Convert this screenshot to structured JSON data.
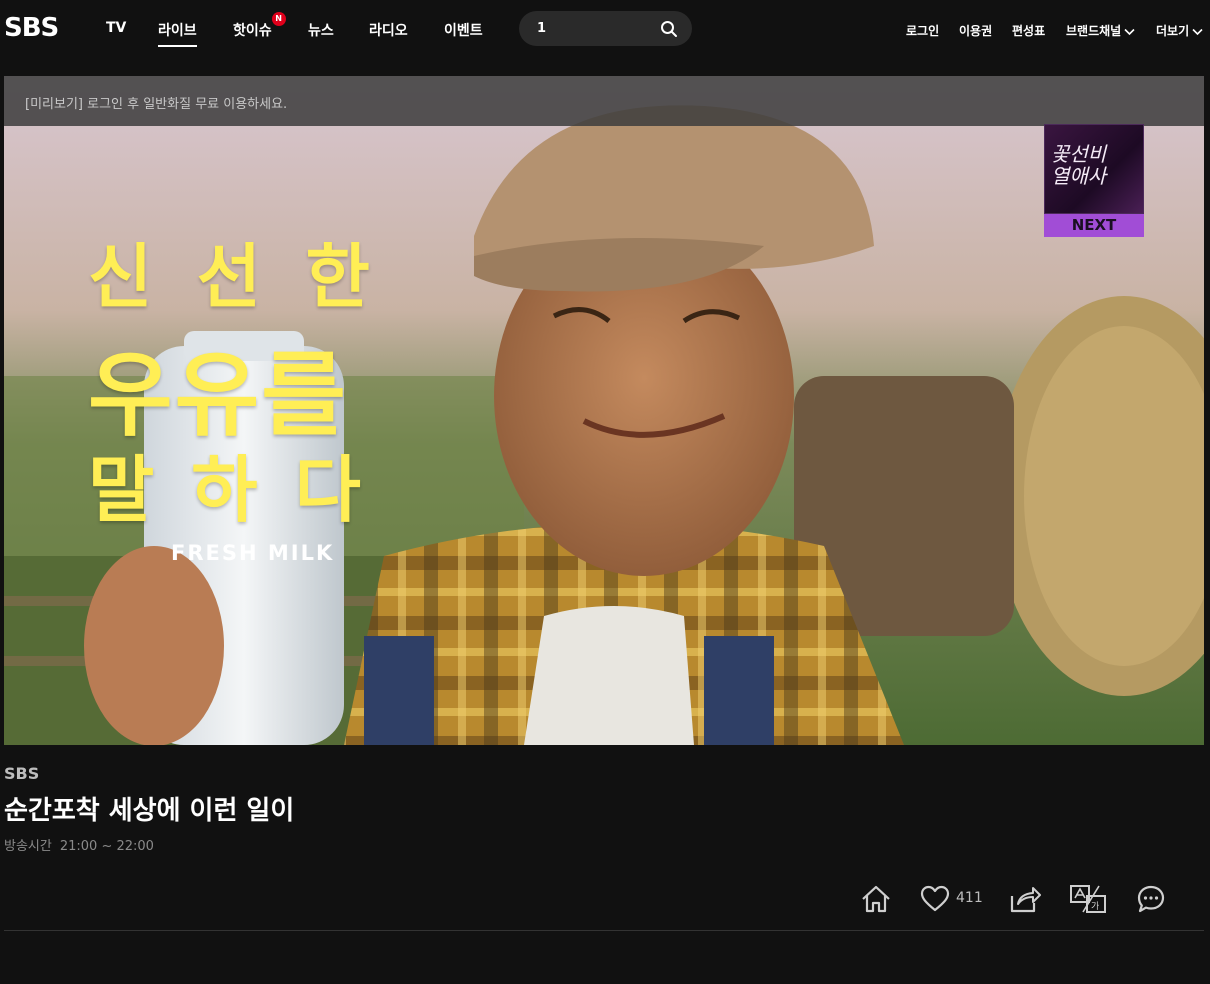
{
  "header": {
    "logo": "SBS",
    "nav": [
      {
        "label": "TV"
      },
      {
        "label": "라이브"
      },
      {
        "label": "핫이슈",
        "badge": "N"
      },
      {
        "label": "뉴스"
      },
      {
        "label": "라디오"
      },
      {
        "label": "이벤트"
      }
    ],
    "search": {
      "value": "1"
    },
    "utility": [
      {
        "label": "로그인"
      },
      {
        "label": "이용권"
      },
      {
        "label": "편성표"
      },
      {
        "label": "브랜드채널"
      },
      {
        "label": "더보기"
      }
    ]
  },
  "player": {
    "preview_notice": "[미리보기] 로그인 후 일반화질 무료 이용하세요.",
    "next": {
      "label": "NEXT",
      "thumb_text": "꽃선비\n열애사"
    },
    "ad": {
      "line1": "신 선 한",
      "line2": "우유를",
      "line3": "말 하 다",
      "product": "FRESH MILK"
    }
  },
  "program": {
    "channel": "SBS",
    "title": "순간포착 세상에 이런 일이",
    "airtime_label": "방송시간",
    "airtime": "21:00 ~ 22:00"
  },
  "actions": {
    "like_count": "411"
  },
  "colors": {
    "background": "#111111",
    "badge": "#e0001b",
    "next_label": "#a14dd6",
    "ad_text": "#ffee55"
  }
}
